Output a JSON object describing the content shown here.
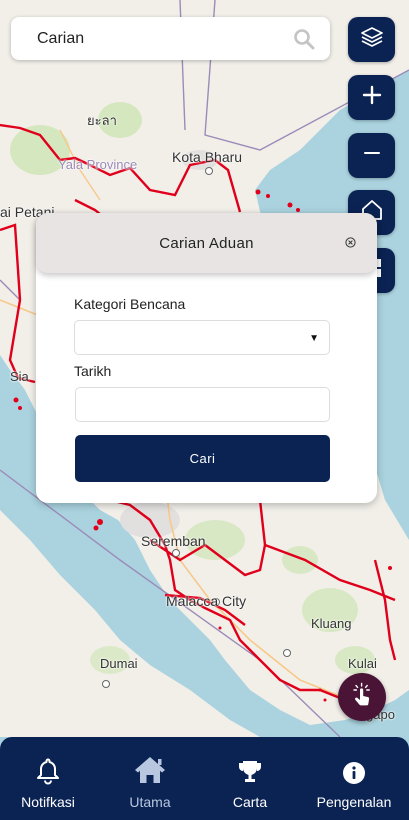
{
  "search": {
    "placeholder": "Carian"
  },
  "map": {
    "places": [
      {
        "name": "ยะลา"
      },
      {
        "name": "Yala Province"
      },
      {
        "name": "Kota Bharu"
      },
      {
        "name": "ai Petani"
      },
      {
        "name": "Seremban"
      },
      {
        "name": "Malacca City"
      },
      {
        "name": "Kluang"
      },
      {
        "name": "Dumai"
      },
      {
        "name": "Kulai"
      },
      {
        "name": "Sia"
      },
      {
        "name": "gapo"
      }
    ],
    "colors": {
      "water": "#aad3df",
      "land": "#f2efe9",
      "border": "#e0001b"
    }
  },
  "map_controls": {
    "layers": "layers-icon",
    "zoom_in": "+",
    "zoom_out": "−",
    "home": "home-icon"
  },
  "modal": {
    "title": "Carian Aduan",
    "close": "⊗",
    "category_label": "Kategori Bencana",
    "category_value": "",
    "date_label": "Tarikh",
    "date_value": "",
    "submit_label": "Cari"
  },
  "nav": {
    "items": [
      {
        "label": "Notifkasi",
        "icon": "bell-icon"
      },
      {
        "label": "Utama",
        "icon": "home-icon",
        "active": true
      },
      {
        "label": "Carta",
        "icon": "trophy-icon"
      },
      {
        "label": "Pengenalan",
        "icon": "info-icon"
      }
    ]
  },
  "theme": {
    "primary": "#0b2353",
    "fab": "#4a1436",
    "modal_header": "#e8e4e4"
  }
}
